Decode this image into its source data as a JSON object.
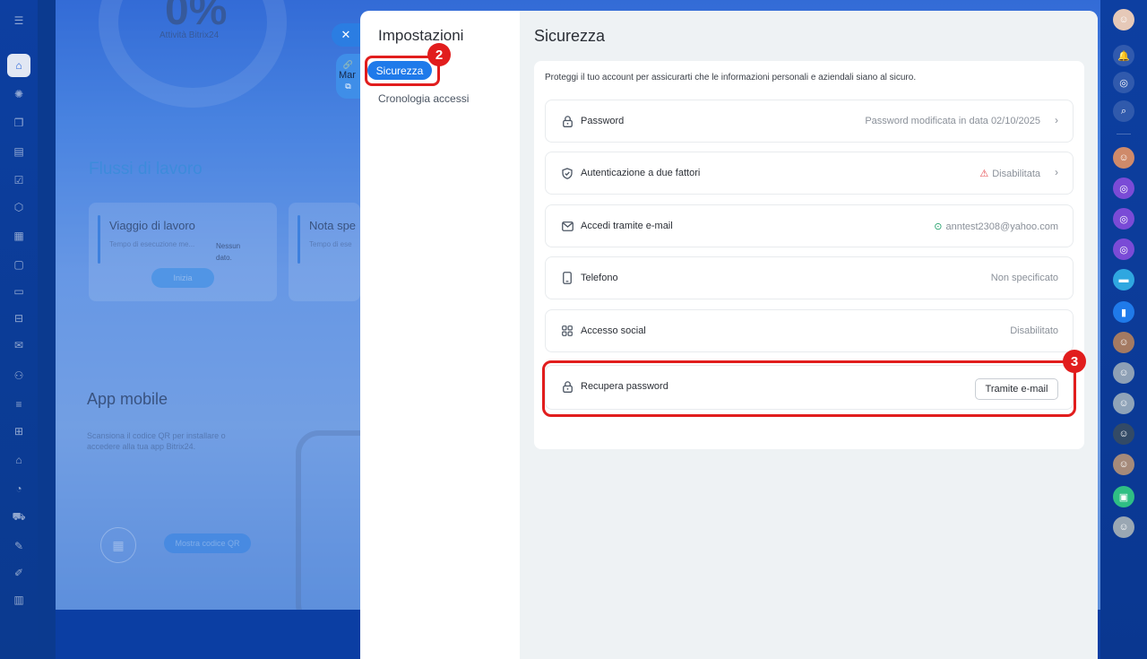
{
  "background": {
    "percent": "0%",
    "percent_label": "Attività Bitrix24",
    "workflows_title": "Flussi di lavoro",
    "workflow_cards": [
      {
        "title": "Viaggio di lavoro",
        "subtitle": "Tempo di esecuzione me...",
        "nodata": "Nessun dato.",
        "button": "Inizia"
      },
      {
        "title": "Nota spe",
        "subtitle": "Tempo di ese"
      }
    ],
    "app_title": "App mobile",
    "app_subtitle": "Scansiona il codice QR per installare o accedere alla tua app Bitrix24.",
    "qr_button": "Mostra codice QR",
    "floating_text": "Mar"
  },
  "settings": {
    "title": "Impostazioni",
    "nav": [
      {
        "label": "Sicurezza",
        "active": true
      },
      {
        "label": "Cronologia accessi",
        "active": false
      }
    ]
  },
  "security": {
    "title": "Sicurezza",
    "description": "Proteggi il tuo account per assicurarti che le informazioni personali e aziendali siano al sicuro.",
    "rows": [
      {
        "label": "Password",
        "value": "Password modificata in data 02/10/2025",
        "icon": "lock-icon"
      },
      {
        "label": "Autenticazione a due fattori",
        "value": "Disabilitata",
        "icon": "shield-icon",
        "status": "warning"
      },
      {
        "label": "Accedi tramite e-mail",
        "value": "anntest2308@yahoo.com",
        "icon": "mail-icon",
        "status": "ok"
      },
      {
        "label": "Telefono",
        "value": "Non specificato",
        "icon": "phone-icon"
      },
      {
        "label": "Accesso social",
        "value": "Disabilitato",
        "icon": "grid-icon"
      },
      {
        "label": "Recupera password",
        "button": "Tramite e-mail",
        "icon": "lock-icon"
      }
    ]
  },
  "callouts": {
    "nav_badge": "2",
    "recover_badge": "3"
  },
  "colors": {
    "accent": "#1f7aea",
    "callout": "#e11d1d",
    "warning": "#e5484d",
    "ok": "#22a06b"
  }
}
